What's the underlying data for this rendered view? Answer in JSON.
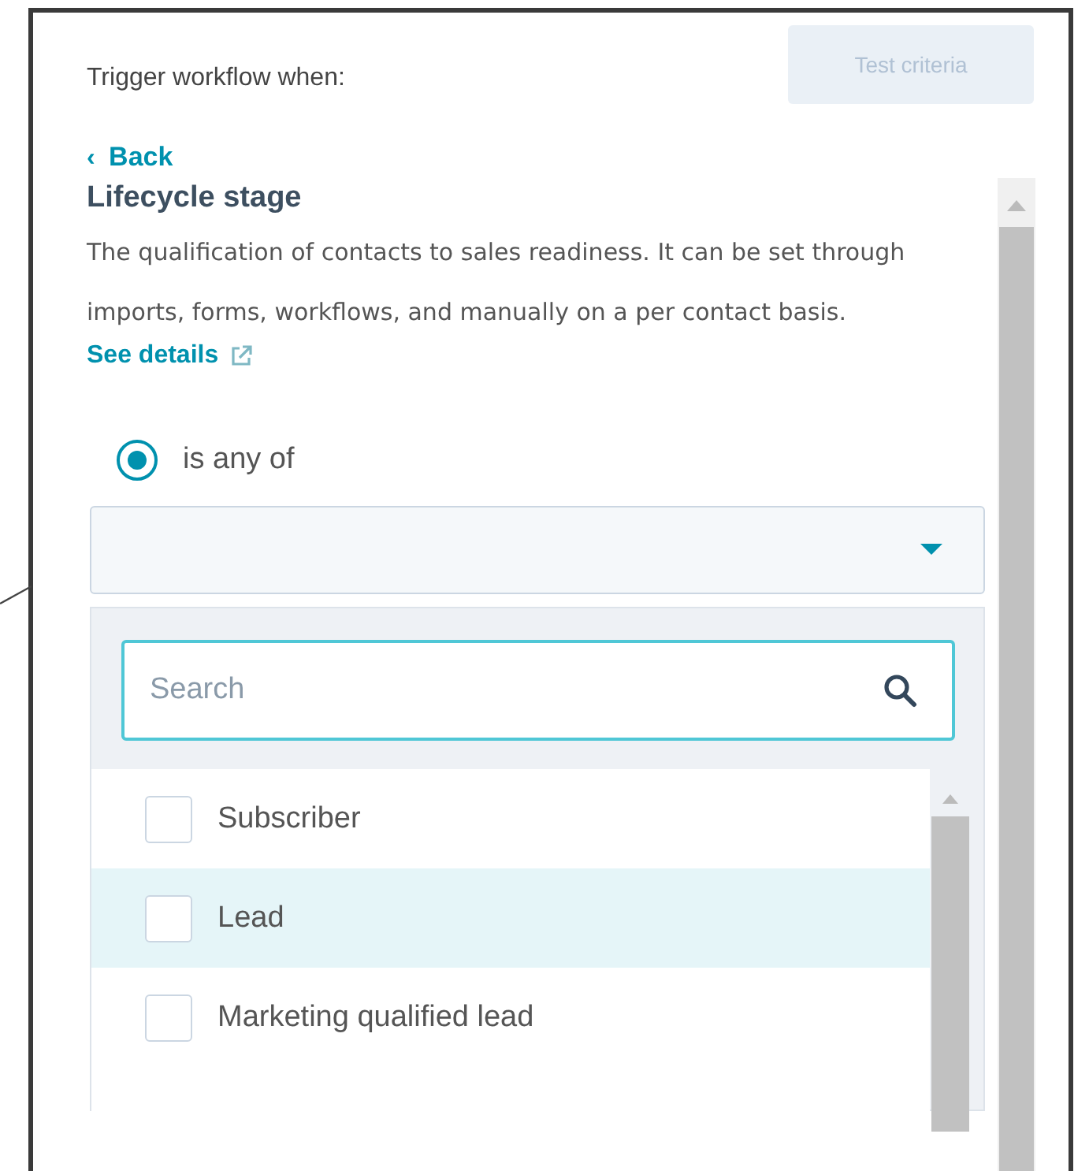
{
  "header": {
    "title": "Trigger workflow when:",
    "test_button": {
      "label": "Test criteria",
      "disabled": true
    }
  },
  "back_link": {
    "arrow": "‹",
    "label": "Back"
  },
  "property": {
    "name": "Lifecycle stage",
    "description": "The qualification of contacts to sales readiness. It can be set through imports, forms, workflows, and manually on a per contact basis.",
    "details_link": "See details"
  },
  "operator": {
    "label": "is any of",
    "selected": true
  },
  "dropdown": {
    "search_placeholder": "Search",
    "options": [
      {
        "label": "Subscriber",
        "checked": false,
        "highlighted": false
      },
      {
        "label": "Lead",
        "checked": false,
        "highlighted": true
      },
      {
        "label": "Marketing qualified lead",
        "checked": false,
        "highlighted": false
      }
    ]
  }
}
